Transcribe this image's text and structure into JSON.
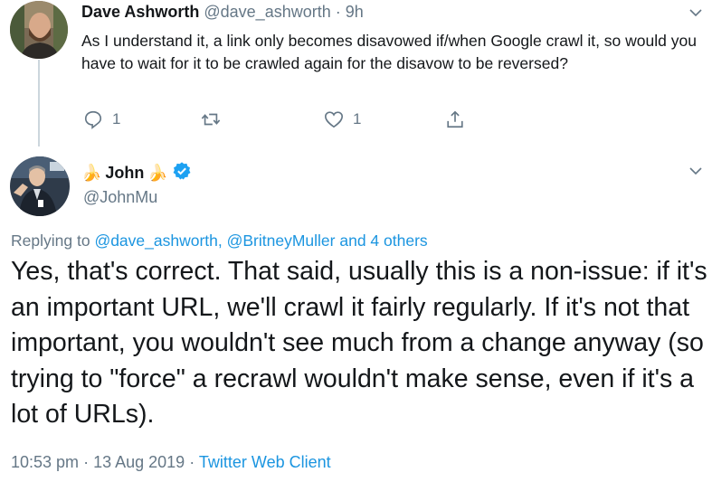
{
  "parent_tweet": {
    "author_name": "Dave Ashworth",
    "handle": "@dave_ashworth",
    "separator": "·",
    "time": "9h",
    "text": "As I understand it, a link only becomes disavowed if/when Google crawl it, so would you have to wait for it to be crawled again for the disavow to be reversed?",
    "reply_count": "1",
    "like_count": "1",
    "icons": [
      "reply-icon",
      "retweet-icon",
      "like-icon",
      "share-icon",
      "chevron-down-icon"
    ]
  },
  "main_tweet": {
    "name_prefix_emoji": "🍌",
    "author_name": "John",
    "name_suffix_emoji": "🍌",
    "handle": "@JohnMu",
    "verified": true,
    "replying_prefix": "Replying to",
    "replying_users": "@dave_ashworth, @BritneyMuller and 4 others",
    "text": "Yes, that's correct. That said, usually this is a non-issue: if it's an important URL, we'll crawl it fairly regularly. If it's not that important, you wouldn't see much from a change anyway (so trying to \"force\" a recrawl wouldn't make sense, even if it's a lot of URLs).",
    "time": "10:53 pm",
    "separator": "·",
    "date": "13 Aug 2019",
    "client": "Twitter Web Client"
  },
  "colors": {
    "accent": "#1b95e0",
    "secondary_text": "#657786",
    "primary_text": "#14171a",
    "thread_line": "#ccd6dd"
  }
}
